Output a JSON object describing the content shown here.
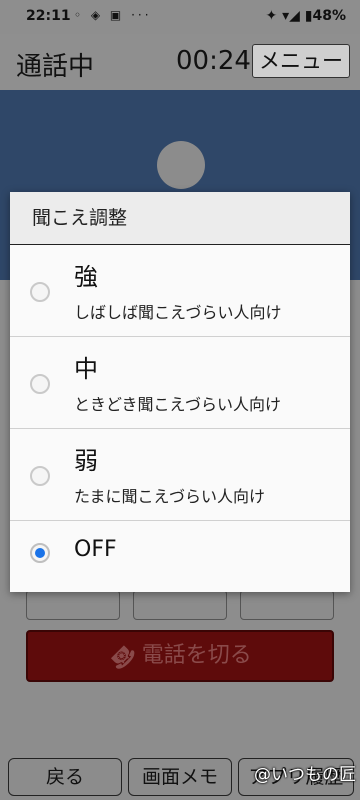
{
  "status_bar": {
    "time": "22:11",
    "left_icons": "◦ ◈ ▣ ···",
    "right_icons": "✦ ▾◢ ▮48%"
  },
  "header": {
    "title": "通話中",
    "timer": "00:24",
    "menu_label": "メニュー"
  },
  "hangup": {
    "icon": "☎",
    "label": "電話を切る",
    "color": "#5e0b0b"
  },
  "bottom_nav": {
    "back": "戻る",
    "memo": "画面メモ",
    "history": "アプリ履歴"
  },
  "watermark": "@いつもの匠",
  "dialog": {
    "title": "聞こえ調整",
    "options": [
      {
        "label": "強",
        "desc": "しばしば聞こえづらい人向け",
        "checked": false
      },
      {
        "label": "中",
        "desc": "ときどき聞こえづらい人向け",
        "checked": false
      },
      {
        "label": "弱",
        "desc": "たまに聞こえづらい人向け",
        "checked": false
      },
      {
        "label": "OFF",
        "desc": "",
        "checked": true
      }
    ],
    "accent_color": "#1a73e8"
  }
}
